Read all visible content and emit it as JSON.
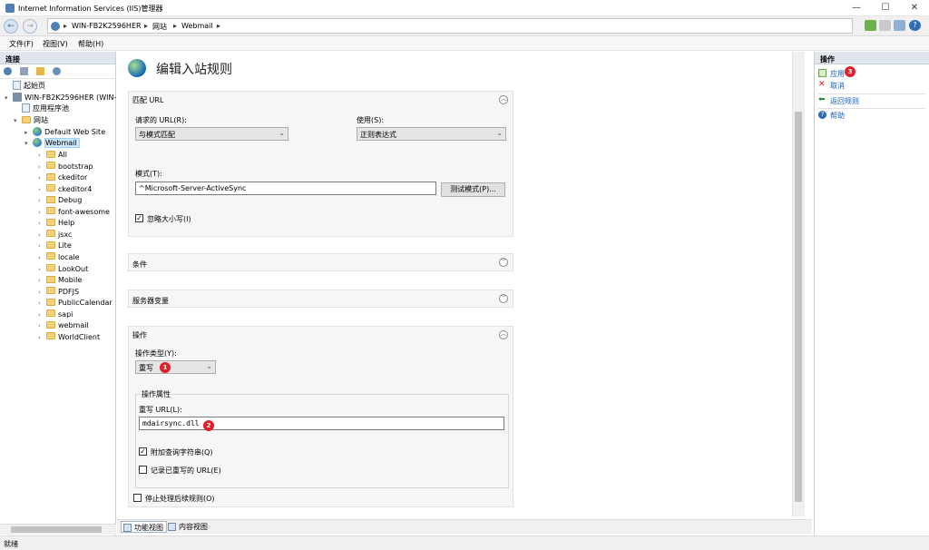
{
  "window": {
    "title": "Internet Information Services (IIS)管理器",
    "minimize": "—",
    "maximize": "☐",
    "close": "✕"
  },
  "address": {
    "segments": [
      "WIN-FB2K2596HER",
      "网站",
      "Webmail"
    ]
  },
  "menu": {
    "file": "文件(F)",
    "view": "视图(V)",
    "help": "帮助(H)"
  },
  "connections": {
    "header": "连接",
    "start_page": "起始页",
    "server": "WIN-FB2K2596HER (WIN-F",
    "app_pools": "应用程序池",
    "sites": "网站",
    "default_site": "Default Web Site",
    "webmail": "Webmail",
    "folders": [
      "All",
      "bootstrap",
      "ckeditor",
      "ckeditor4",
      "Debug",
      "font-awesome",
      "Help",
      "jsxc",
      "Lite",
      "locale",
      "LookOut",
      "Mobile",
      "PDFJS",
      "PublicCalendar",
      "sapi",
      "webmail",
      "WorldClient"
    ]
  },
  "page": {
    "title": "编辑入站规则",
    "match_section": {
      "header": "匹配 URL",
      "requested_url_label": "请求的 URL(R):",
      "requested_url_value": "与模式匹配",
      "using_label": "使用(S):",
      "using_value": "正则表达式",
      "pattern_label": "模式(T):",
      "pattern_value": "^Microsoft-Server-ActiveSync",
      "test_button": "测试模式(P)...",
      "ignore_case": "忽略大小写(I)"
    },
    "conditions_header": "条件",
    "server_vars_header": "服务器变量",
    "action_section": {
      "header": "操作",
      "action_type_label": "操作类型(Y):",
      "action_type_value": "重写",
      "props_header": "操作属性",
      "rewrite_url_label": "重写 URL(L):",
      "rewrite_url_value": "mdairsync.dll",
      "append_query": "附加查询字符串(Q)",
      "log_rewritten": "记录已重写的 URL(E)",
      "stop_processing": "停止处理后续规则(O)"
    },
    "badges": [
      "1",
      "2",
      "3"
    ]
  },
  "view_tabs": {
    "features": "功能视图",
    "content": "内容视图"
  },
  "actions": {
    "header": "操作",
    "apply": "应用",
    "cancel": "取消",
    "back": "返回规则",
    "help": "帮助"
  },
  "status": {
    "text": "就绪"
  }
}
